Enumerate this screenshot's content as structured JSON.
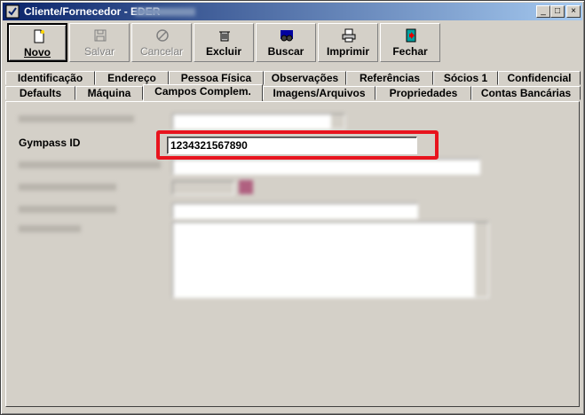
{
  "window": {
    "title": "Cliente/Fornecedor - EDER",
    "controls": {
      "minimize": "_",
      "maximize": "□",
      "close": "×"
    }
  },
  "toolbar": {
    "buttons": [
      {
        "label": "Novo",
        "icon": "new-document-icon"
      },
      {
        "label": "Salvar",
        "icon": "floppy-disk-icon"
      },
      {
        "label": "Cancelar",
        "icon": "cancel-circle-icon"
      },
      {
        "label": "Excluir",
        "icon": "trash-icon"
      },
      {
        "label": "Buscar",
        "icon": "search-binoculars-icon"
      },
      {
        "label": "Imprimir",
        "icon": "printer-icon"
      },
      {
        "label": "Fechar",
        "icon": "exit-door-icon"
      }
    ]
  },
  "tabs": {
    "row1": [
      "Identificação",
      "Endereço",
      "Pessoa Física",
      "Observações",
      "Referências",
      "Sócios 1",
      "Confidencial"
    ],
    "row2": [
      "Defaults",
      "Máquina",
      "Campos Complem.",
      "Imagens/Arquivos",
      "Propriedades",
      "Contas Bancárias"
    ],
    "selected": "Campos Complem."
  },
  "fields": {
    "gympass": {
      "label": "Gympass ID",
      "value": "1234321567890"
    }
  },
  "colors": {
    "highlight": "#e8141e",
    "window_bg": "#d4d0c8",
    "title_start": "#0a246a",
    "title_end": "#a6caf0"
  }
}
